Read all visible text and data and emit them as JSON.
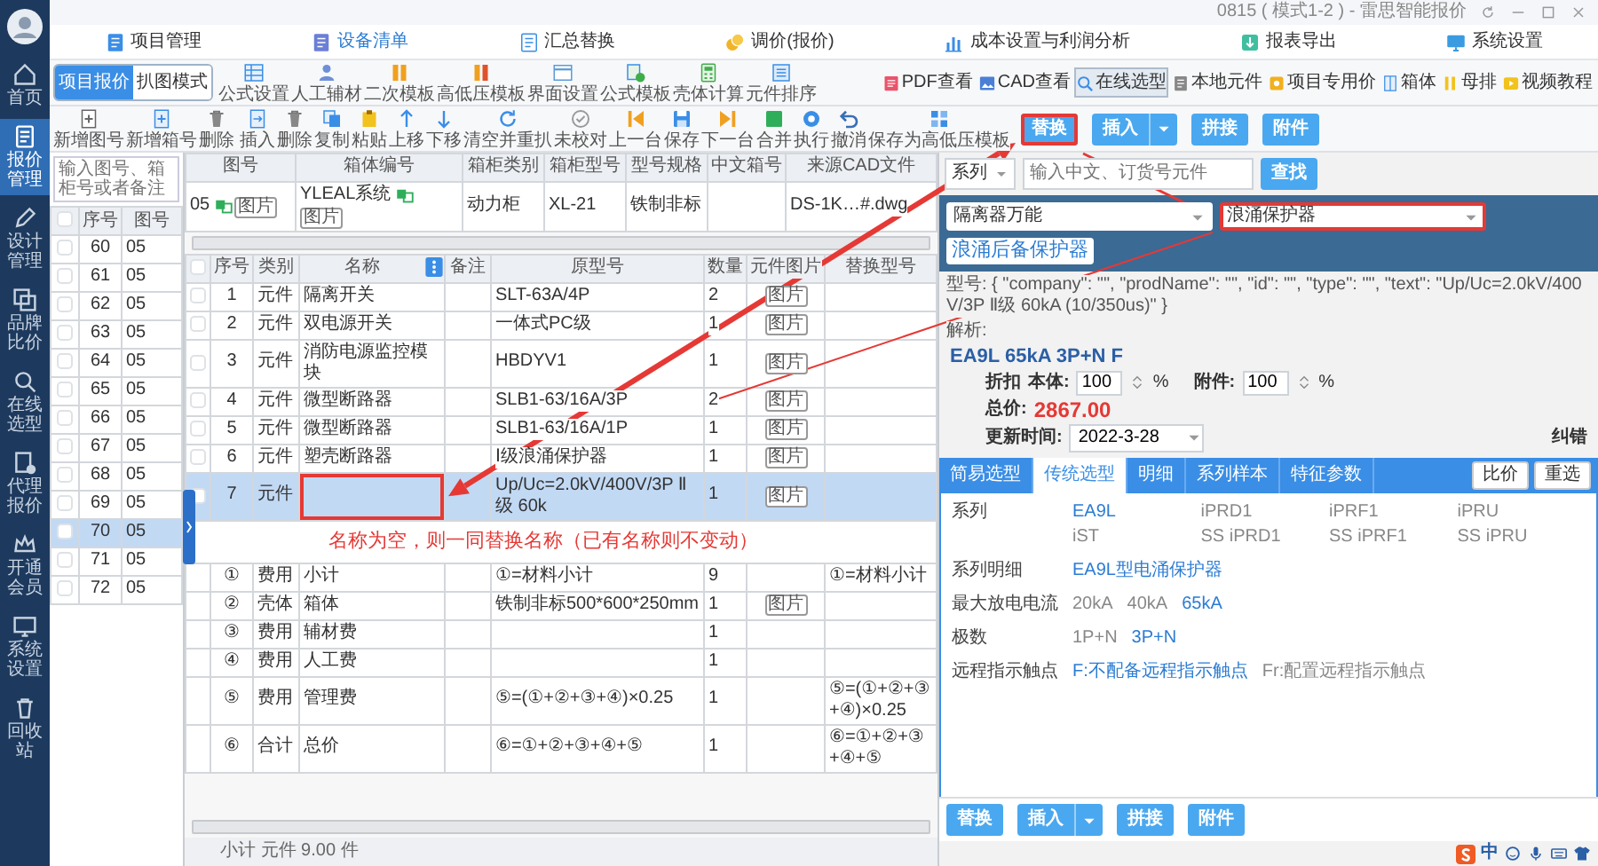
{
  "window": {
    "title": "0815 ( 模式1-2 ) - 雷思智能报价"
  },
  "sidebar": {
    "items": [
      {
        "label": "首页",
        "kind": "home",
        "selected": false
      },
      {
        "label": "报价管理",
        "kind": "doc",
        "selected": true
      },
      {
        "label": "设计管理",
        "kind": "pen",
        "selected": false
      },
      {
        "label": "品牌比价",
        "kind": "compare",
        "selected": false
      },
      {
        "label": "在线选型",
        "kind": "search",
        "selected": false
      },
      {
        "label": "代理报价",
        "kind": "agent",
        "selected": false
      },
      {
        "label": "开通会员",
        "kind": "crown",
        "selected": false
      },
      {
        "label": "系统设置",
        "kind": "monitor",
        "selected": false
      },
      {
        "label": "回收站",
        "kind": "trash",
        "selected": false
      }
    ]
  },
  "menu": [
    {
      "label": "项目管理",
      "kind": "folder",
      "selected": false
    },
    {
      "label": "设备清单",
      "kind": "list",
      "selected": true
    },
    {
      "label": "汇总替换",
      "kind": "summary",
      "selected": false
    },
    {
      "label": "调价(报价)",
      "kind": "coins",
      "selected": false
    },
    {
      "label": "成本设置与利润分析",
      "kind": "chart",
      "selected": false
    },
    {
      "label": "报表导出",
      "kind": "export",
      "selected": false
    },
    {
      "label": "系统设置",
      "kind": "screen",
      "selected": false
    }
  ],
  "mode_tabs": [
    {
      "label": "项目报价",
      "selected": true
    },
    {
      "label": "扒图模式",
      "selected": false
    }
  ],
  "tools": [
    {
      "label": "公式设置",
      "kind": "grid"
    },
    {
      "label": "人工辅材",
      "kind": "person"
    },
    {
      "label": "二次模板",
      "kind": "bars"
    },
    {
      "label": "高低压模板",
      "kind": "bars2"
    },
    {
      "label": "界面设置",
      "kind": "window"
    },
    {
      "label": "公式模板",
      "kind": "formula"
    },
    {
      "label": "壳体计算",
      "kind": "calc"
    },
    {
      "label": "元件排序",
      "kind": "sort"
    }
  ],
  "viewers": [
    {
      "label": "PDF查看",
      "kind": "pdf",
      "selected": false
    },
    {
      "label": "CAD查看",
      "kind": "cad",
      "selected": false
    },
    {
      "label": "在线选型",
      "kind": "search2",
      "selected": true
    },
    {
      "label": "本地元件",
      "kind": "local",
      "selected": false
    },
    {
      "label": "项目专用价",
      "kind": "price",
      "selected": false
    },
    {
      "label": "箱体",
      "kind": "box",
      "selected": false
    },
    {
      "label": "母排",
      "kind": "busbar",
      "selected": false
    },
    {
      "label": "视频教程",
      "kind": "video",
      "selected": false
    }
  ],
  "drawing_tools": [
    {
      "label": "新增图号",
      "kind": "newdoc"
    },
    {
      "label": "新增箱号",
      "kind": "newbox"
    },
    {
      "label": "删除",
      "kind": "trash2"
    }
  ],
  "edit_tools": [
    {
      "label": "插入",
      "kind": "insert"
    },
    {
      "label": "删除",
      "kind": "trash2"
    },
    {
      "label": "复制",
      "kind": "copy"
    },
    {
      "label": "粘贴",
      "kind": "paste"
    },
    {
      "label": "上移",
      "kind": "up"
    },
    {
      "label": "下移",
      "kind": "down"
    },
    {
      "label": "清空并重扒",
      "kind": "refresh"
    },
    {
      "label": "未校对",
      "kind": "check"
    },
    {
      "label": "上一台",
      "kind": "prev"
    },
    {
      "label": "保存",
      "kind": "save"
    },
    {
      "label": "下一台",
      "kind": "next"
    },
    {
      "label": "合并",
      "kind": "merge"
    },
    {
      "label": "执行",
      "kind": "run"
    },
    {
      "label": "撤消",
      "kind": "undo"
    },
    {
      "label": "保存为高低压模板",
      "kind": "template"
    }
  ],
  "actions": [
    {
      "label": "替换",
      "kind": "button",
      "highlighted": true
    },
    {
      "label": "插入",
      "kind": "split",
      "highlighted": false
    },
    {
      "label": "拼接",
      "kind": "button",
      "highlighted": false
    },
    {
      "label": "附件",
      "kind": "button",
      "highlighted": false
    }
  ],
  "drawing_list": {
    "placeholder": "输入图号、箱柜号或者备注",
    "columns": [
      "序号",
      "图号"
    ],
    "all_checked": false,
    "rows": [
      {
        "no": "60",
        "drawing": "05",
        "checked": false,
        "selected": false
      },
      {
        "no": "61",
        "drawing": "05",
        "checked": false,
        "selected": false
      },
      {
        "no": "62",
        "drawing": "05",
        "checked": false,
        "selected": false
      },
      {
        "no": "63",
        "drawing": "05",
        "checked": false,
        "selected": false
      },
      {
        "no": "64",
        "drawing": "05",
        "checked": false,
        "selected": false
      },
      {
        "no": "65",
        "drawing": "05",
        "checked": false,
        "selected": false
      },
      {
        "no": "66",
        "drawing": "05",
        "checked": false,
        "selected": false
      },
      {
        "no": "67",
        "drawing": "05",
        "checked": false,
        "selected": false
      },
      {
        "no": "68",
        "drawing": "05",
        "checked": false,
        "selected": false
      },
      {
        "no": "69",
        "drawing": "05",
        "checked": false,
        "selected": false
      },
      {
        "no": "70",
        "drawing": "05",
        "checked": false,
        "selected": true
      },
      {
        "no": "71",
        "drawing": "05",
        "checked": false,
        "selected": false
      },
      {
        "no": "72",
        "drawing": "05",
        "checked": false,
        "selected": false
      }
    ]
  },
  "cabinet": {
    "columns": [
      "图号",
      "箱体编号",
      "箱柜类别",
      "箱柜型号",
      "型号规格",
      "中文箱号",
      "来源CAD文件"
    ],
    "row": {
      "drawing_no": "05",
      "drawing_badge": "图片",
      "cabinet_no": "YLEAL系统",
      "cabinet_badge": "图片",
      "category": "动力柜",
      "model": "XL-21",
      "spec": "铁制非标",
      "cad_file": "DS-1K…#.dwg"
    }
  },
  "items": {
    "columns": [
      "序号",
      "类别",
      "名称",
      "备注",
      "原型号",
      "数量",
      "元件图片",
      "替换型号"
    ],
    "all_checked": false,
    "rows": [
      {
        "no": "1",
        "category": "元件",
        "name": "隔离开关",
        "model": "SLT-63A/4P",
        "qty": "2",
        "badge": "图片",
        "checked": false,
        "selected": false,
        "highlighted": false
      },
      {
        "no": "2",
        "category": "元件",
        "name": "双电源开关",
        "model": "一体式PC级",
        "qty": "1",
        "badge": "图片",
        "checked": false,
        "selected": false,
        "highlighted": false
      },
      {
        "no": "3",
        "category": "元件",
        "name": "消防电源监控模块",
        "model": "HBDYV1",
        "qty": "1",
        "badge": "图片",
        "checked": false,
        "selected": false,
        "highlighted": false
      },
      {
        "no": "4",
        "category": "元件",
        "name": "微型断路器",
        "model": "SLB1-63/16A/3P",
        "qty": "2",
        "badge": "图片",
        "checked": false,
        "selected": false,
        "highlighted": false
      },
      {
        "no": "5",
        "category": "元件",
        "name": "微型断路器",
        "model": "SLB1-63/16A/1P",
        "qty": "1",
        "badge": "图片",
        "checked": false,
        "selected": false,
        "highlighted": false
      },
      {
        "no": "6",
        "category": "元件",
        "name": "塑壳断路器",
        "model": "Ⅰ级浪涌保护器",
        "qty": "1",
        "badge": "图片",
        "checked": false,
        "selected": false,
        "highlighted": false
      },
      {
        "no": "7",
        "category": "元件",
        "model": "Up/Uc=2.0kV/400V/3P Ⅱ级 60k",
        "qty": "1",
        "badge": "图片",
        "checked": false,
        "selected": true,
        "highlighted": true
      }
    ],
    "annotation": "名称为空，则一同替换名称（已有名称则不变动）",
    "summary": [
      {
        "no": "①",
        "category": "费用",
        "name": "小计",
        "model": "①=材料小计",
        "qty": "9",
        "replacement": "①=材料小计"
      },
      {
        "no": "②",
        "category": "壳体",
        "name": "箱体",
        "model": "铁制非标500*600*250mm",
        "qty": "1",
        "badge": "图片"
      },
      {
        "no": "③",
        "category": "费用",
        "name": "辅材费",
        "qty": "1"
      },
      {
        "no": "④",
        "category": "费用",
        "name": "人工费",
        "qty": "1"
      },
      {
        "no": "⑤",
        "category": "费用",
        "name": "管理费",
        "model": "⑤=(①+②+③+④)×0.25",
        "qty": "1",
        "replacement": "⑤=(①+②+③+④)×0.25"
      },
      {
        "no": "⑥",
        "category": "合计",
        "name": "总价",
        "model": "⑥=①+②+③+④+⑤",
        "qty": "1",
        "replacement": "⑥=①+②+③+④+⑤"
      }
    ]
  },
  "status": "小计 元件 9.00 件",
  "finder": {
    "scope": "系列",
    "placeholder": "输入中文、订货号元件",
    "button": "查找"
  },
  "category_selects": [
    {
      "value": "隔离器万能",
      "highlighted": false
    },
    {
      "value": "浪涌保护器",
      "highlighted": true
    }
  ],
  "subcategory": "浪涌后备保护器",
  "raw_type": "型号: { \"company\": \"\", \"prodName\": \"\", \"id\": \"\", \"type\": \"\", \"text\": \"Up/Uc=2.0kV/400V/3P Ⅱ级 60kA (10/350us)\" }",
  "parse_label": "解析:",
  "result": {
    "model": "EA9L 65kA 3P+N F",
    "discount_label": "折扣",
    "body_label": "本体:",
    "body_value": "100",
    "body_unit": "%",
    "attach_label": "附件:",
    "attach_value": "100",
    "attach_unit": "%",
    "total_label": "总价:",
    "total": "2867.00",
    "updated_label": "更新时间:",
    "updated": "2022-3-28",
    "report": "纠错"
  },
  "tabs": [
    {
      "label": "简易选型",
      "selected": false
    },
    {
      "label": "传统选型",
      "selected": true
    },
    {
      "label": "明细",
      "selected": false
    },
    {
      "label": "系列样本",
      "selected": false
    },
    {
      "label": "特征参数",
      "selected": false
    }
  ],
  "tab_buttons": [
    "比价",
    "重选"
  ],
  "params": [
    {
      "label": "系列",
      "kind": "grid",
      "options": [
        {
          "text": "EA9L",
          "selected": true
        },
        {
          "text": "iPRD1",
          "selected": false
        },
        {
          "text": "iPRF1",
          "selected": false
        },
        {
          "text": "iPRU",
          "selected": false
        },
        {
          "text": "iST",
          "selected": false
        },
        {
          "text": "SS iPRD1",
          "selected": false
        },
        {
          "text": "SS iPRF1",
          "selected": false
        },
        {
          "text": "SS iPRU",
          "selected": false
        }
      ]
    },
    {
      "label": "系列明细",
      "kind": "inline",
      "options": [
        {
          "text": "EA9L型电涌保护器",
          "selected": true
        }
      ]
    },
    {
      "label": "最大放电电流",
      "kind": "inline",
      "options": [
        {
          "text": "20kA",
          "selected": false
        },
        {
          "text": "40kA",
          "selected": false
        },
        {
          "text": "65kA",
          "selected": true
        }
      ]
    },
    {
      "label": "极数",
      "kind": "inline",
      "options": [
        {
          "text": "1P+N",
          "selected": false
        },
        {
          "text": "3P+N",
          "selected": true
        }
      ]
    },
    {
      "label": "远程指示触点",
      "kind": "inline",
      "options": [
        {
          "text": "F:不配备远程指示触点",
          "selected": true
        },
        {
          "text": "Fr:配置远程指示触点",
          "selected": false
        }
      ]
    }
  ],
  "bottom_actions": [
    {
      "label": "替换",
      "kind": "button"
    },
    {
      "label": "插入",
      "kind": "split"
    },
    {
      "label": "拼接",
      "kind": "button"
    },
    {
      "label": "附件",
      "kind": "button"
    }
  ],
  "ime": {
    "label": "中"
  }
}
